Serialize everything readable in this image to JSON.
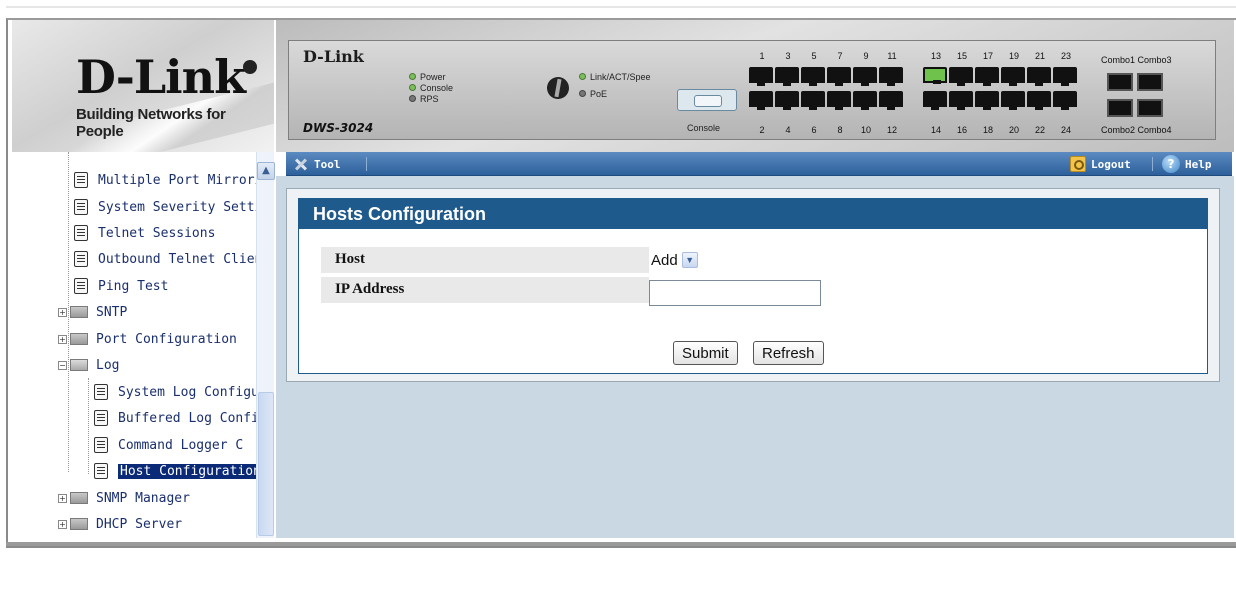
{
  "header": {
    "logo_text": "D-Link",
    "logo_tagline": "Building Networks for People",
    "device_brand": "D-Link",
    "device_model": "DWS-3024",
    "leds_left": [
      "Power",
      "Console",
      "RPS"
    ],
    "leds_right": [
      "Link/ACT/Spee",
      "PoE"
    ],
    "console_label": "Console",
    "ports_top_a": [
      "1",
      "3",
      "5",
      "7",
      "9",
      "11"
    ],
    "ports_top_b": [
      "13",
      "15",
      "17",
      "19",
      "21",
      "23"
    ],
    "ports_bottom_a": [
      "2",
      "4",
      "6",
      "8",
      "10",
      "12"
    ],
    "ports_bottom_b": [
      "14",
      "16",
      "18",
      "20",
      "22",
      "24"
    ],
    "combo_top": "Combo1 Combo3",
    "combo_bottom": "Combo2 Combo4"
  },
  "toolbar": {
    "tool_label": "Tool",
    "logout_label": "Logout",
    "help_label": "Help"
  },
  "sidebar": {
    "items": [
      {
        "label": "Multiple Port Mirroring",
        "type": "doc",
        "level": 1
      },
      {
        "label": "System Severity Setti",
        "type": "doc",
        "level": 1
      },
      {
        "label": "Telnet Sessions",
        "type": "doc",
        "level": 1
      },
      {
        "label": "Outbound Telnet Clien",
        "type": "doc",
        "level": 1
      },
      {
        "label": "Ping Test",
        "type": "doc",
        "level": 1
      },
      {
        "label": "SNTP",
        "type": "folder",
        "level": 1,
        "expander": "+"
      },
      {
        "label": "Port Configuration",
        "type": "folder",
        "level": 1,
        "expander": "+"
      },
      {
        "label": "Log",
        "type": "folder-open",
        "level": 1,
        "expander": "−"
      },
      {
        "label": "System Log Configu",
        "type": "doc",
        "level": 2
      },
      {
        "label": "Buffered Log Config",
        "type": "doc",
        "level": 2
      },
      {
        "label": "Command Logger C",
        "type": "doc",
        "level": 2
      },
      {
        "label": "Host Configuration",
        "type": "doc",
        "level": 2,
        "selected": true
      },
      {
        "label": "SNMP Manager",
        "type": "folder",
        "level": 1,
        "expander": "+"
      },
      {
        "label": "DHCP Server",
        "type": "folder",
        "level": 1,
        "expander": "+"
      }
    ]
  },
  "main": {
    "panel_title": "Hosts Configuration",
    "fields": {
      "host_label": "Host",
      "host_value": "Add",
      "ip_label": "IP Address",
      "ip_value": ""
    },
    "buttons": {
      "submit": "Submit",
      "refresh": "Refresh"
    }
  },
  "colors": {
    "toolbar": "#2d5f9b",
    "panel_header": "#1e5a8c",
    "background": "#c9d8e3",
    "selected_item": "#0a2a78"
  }
}
